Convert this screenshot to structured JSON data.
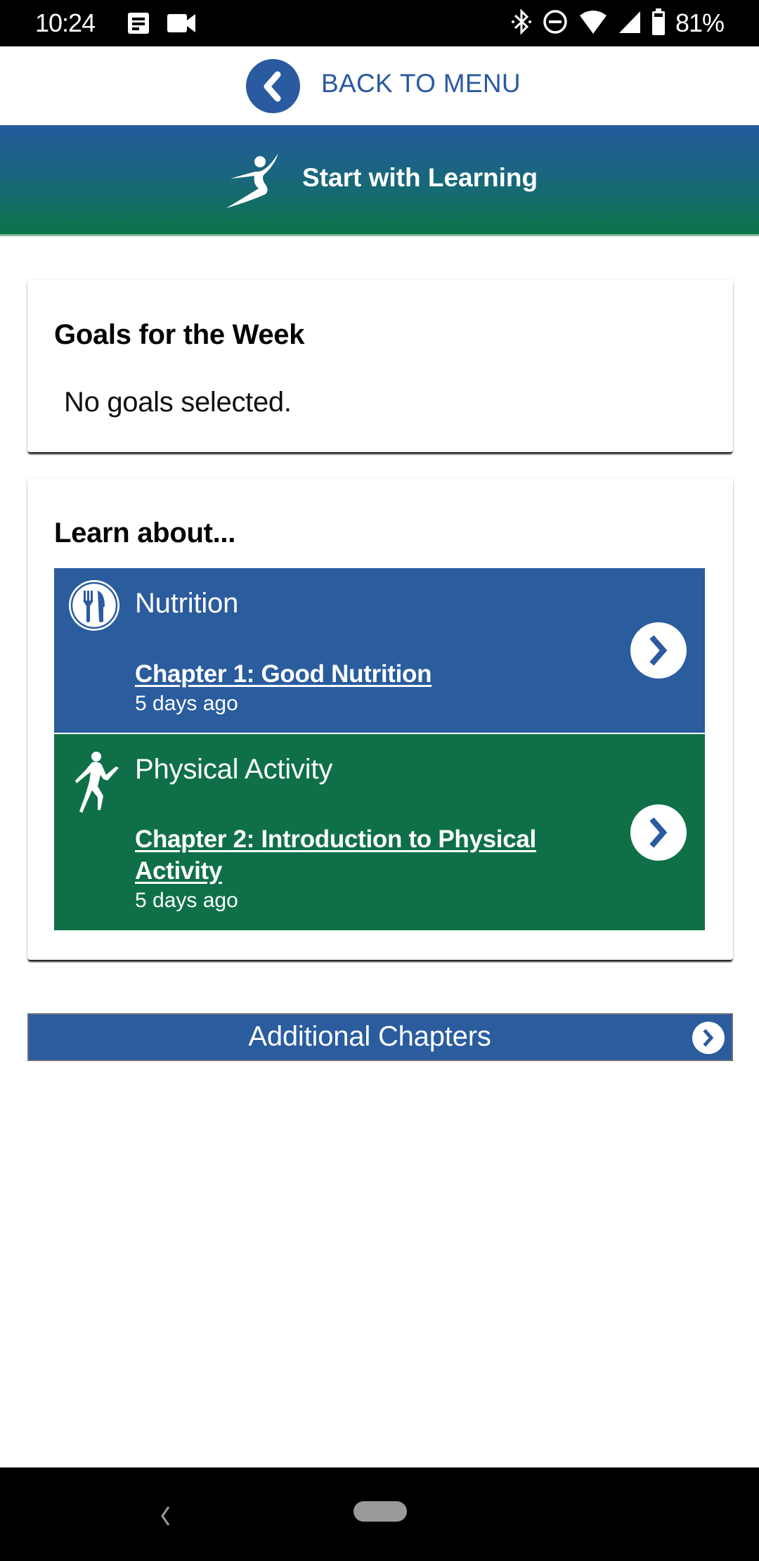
{
  "status_bar": {
    "time": "10:24",
    "left_icons": [
      "news-notification-icon",
      "video-camera-icon"
    ],
    "right_icons": [
      "bluetooth-icon",
      "do-not-disturb-icon",
      "wifi-icon",
      "cell-signal-icon",
      "battery-icon"
    ],
    "battery_percent": "81%"
  },
  "back_bar": {
    "icon": "chevron-left-icon",
    "label": "BACK TO MENU"
  },
  "header": {
    "icon": "leaping-figure-icon",
    "title": "Start with Learning"
  },
  "goals_card": {
    "title": "Goals for the Week",
    "empty_text": "No goals selected."
  },
  "learn_card": {
    "title": "Learn about...",
    "topics": [
      {
        "name": "Nutrition",
        "icon": "fork-knife-icon",
        "chapter": "Chapter 1: Good Nutrition",
        "time": "5 days ago",
        "color": "#2a5c9e",
        "arrow_icon": "chevron-right-icon"
      },
      {
        "name": "Physical Activity",
        "icon": "running-figure-icon",
        "chapter": "Chapter 2: Introduction to Physical Activity",
        "time": "5 days ago",
        "color": "#0f7047",
        "arrow_icon": "chevron-right-icon"
      }
    ]
  },
  "additional": {
    "label": "Additional Chapters",
    "arrow_icon": "chevron-right-icon"
  },
  "nav_bar": {
    "buttons": [
      "back",
      "home"
    ]
  },
  "colors": {
    "brand_blue": "#2a5aa0",
    "brand_green": "#0f7047",
    "header_gradient_top": "#245a9c",
    "header_gradient_bottom": "#0b7448"
  }
}
